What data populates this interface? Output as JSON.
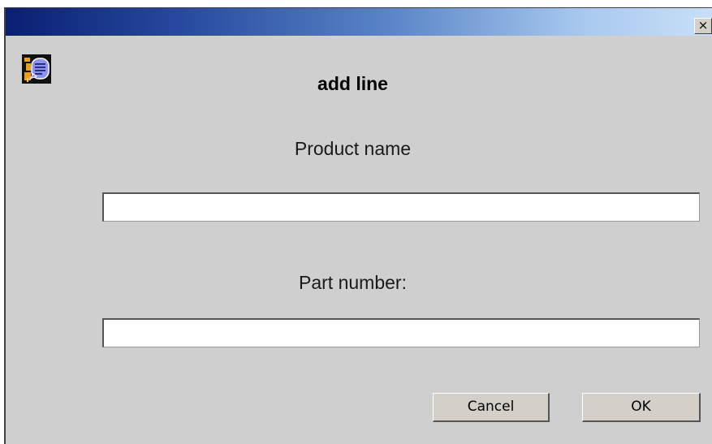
{
  "window": {
    "title": "",
    "close_label": "×"
  },
  "dialog": {
    "title": "add line",
    "icon": "speech-bubble-person-icon"
  },
  "fields": {
    "product_name": {
      "label": "Product name",
      "value": "",
      "placeholder": ""
    },
    "part_number": {
      "label": "Part number:",
      "value": "",
      "placeholder": ""
    }
  },
  "buttons": {
    "cancel_label": "Cancel",
    "ok_label": "OK"
  },
  "colors": {
    "dialog_background": "#cfcfcf",
    "titlebar_start": "#0a1f73",
    "titlebar_end": "#c8dff7",
    "button_face": "#d4d0c8",
    "icon_accent": "#e8a020",
    "icon_bubble": "#8d93f0"
  }
}
